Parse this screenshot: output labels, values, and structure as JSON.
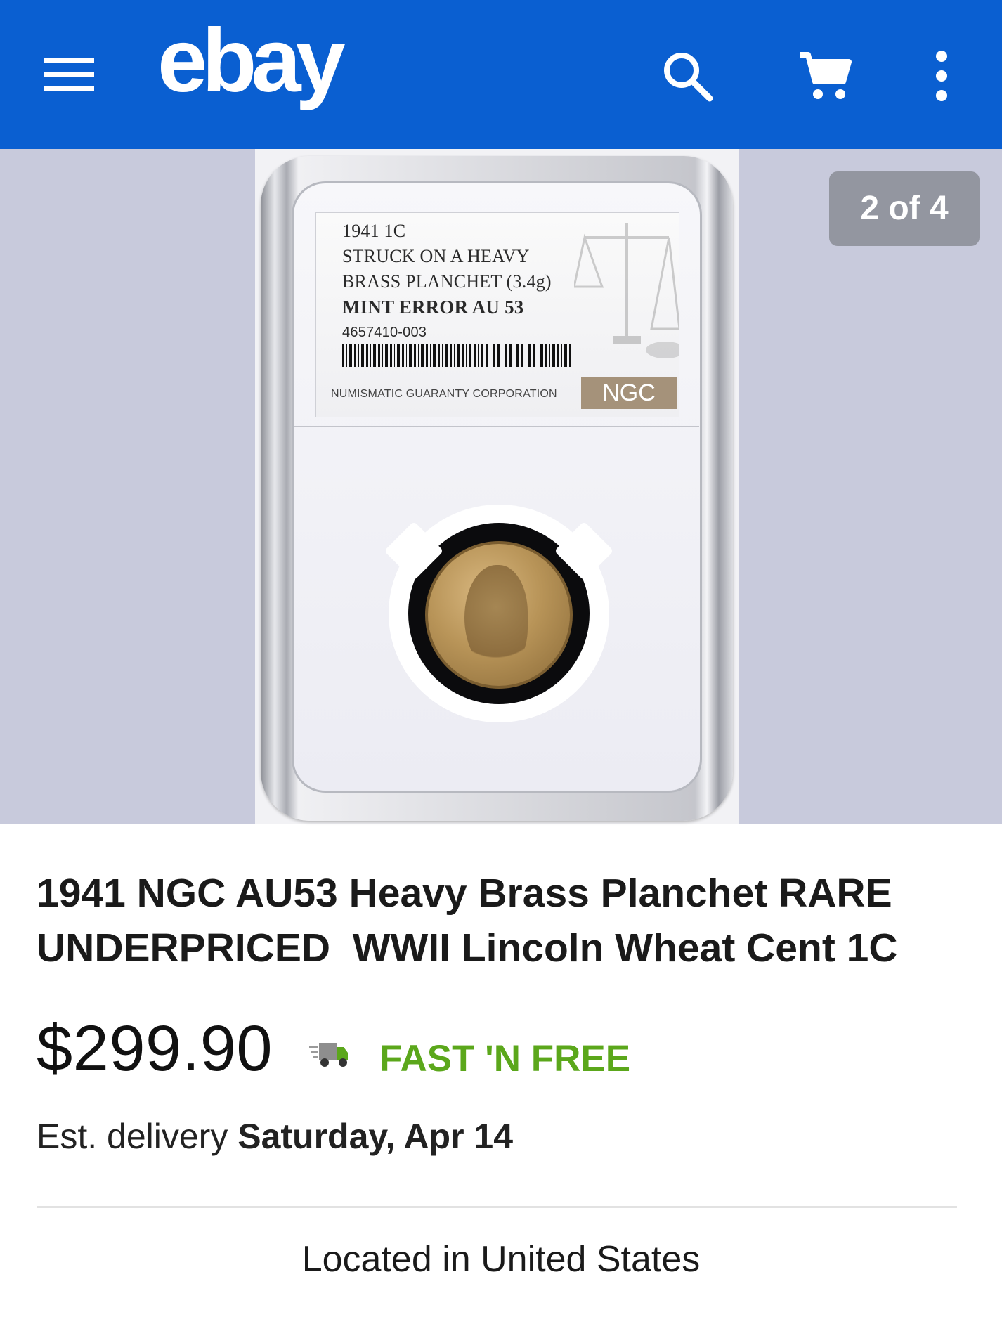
{
  "header": {
    "logo_text": "ebay",
    "background_color": "#0a5fd1",
    "icons": {
      "menu": "hamburger-menu-icon",
      "search": "search-icon",
      "cart": "cart-icon",
      "more": "more-vertical-icon"
    }
  },
  "gallery": {
    "counter": "2 of 4",
    "slab_label": {
      "line1": "1941  1C",
      "line2": "STRUCK ON A HEAVY",
      "line3": "BRASS PLANCHET (3.4g)",
      "line4": "MINT ERROR AU 53",
      "cert_number": "4657410-003",
      "company": "NUMISMATIC GUARANTY CORPORATION",
      "brand": "NGC"
    }
  },
  "listing": {
    "title": "1941 NGC AU53 Heavy Brass Planchet RARE UNDERPRICED  WWII Lincoln Wheat Cent 1C",
    "price": "$299.90",
    "shipping_label": "FAST 'N FREE",
    "shipping_color": "#5ba71b",
    "delivery_prefix": "Est. delivery",
    "delivery_date": "Saturday, Apr 14",
    "location": "Located in United States"
  }
}
